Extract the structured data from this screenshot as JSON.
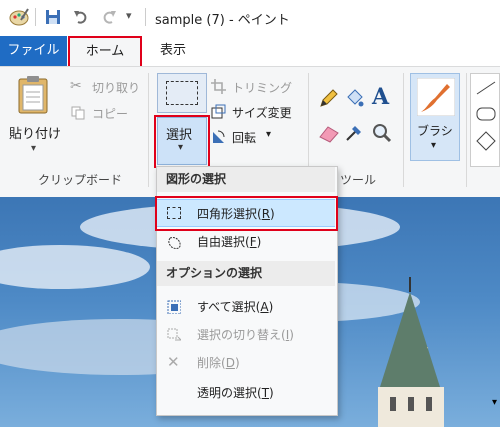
{
  "window": {
    "title": "sample (7) - ペイント"
  },
  "tabs": {
    "file": "ファイル",
    "home": "ホーム",
    "view": "表示"
  },
  "ribbon": {
    "clipboard": {
      "group_label": "クリップボード",
      "paste": "貼り付け",
      "cut": "切り取り",
      "copy": "コピー"
    },
    "image": {
      "select": "選択",
      "crop": "トリミング",
      "resize": "サイズ変更",
      "rotate": "回転"
    },
    "tools": {
      "group_label": "ツール"
    },
    "brushes": {
      "label": "ブラシ"
    }
  },
  "select_menu": {
    "shape_header": "図形の選択",
    "options_header": "オプションの選択",
    "items": [
      {
        "label": "四角形選択(",
        "key": "R",
        "close": ")",
        "enabled": true
      },
      {
        "label": "自由選択(",
        "key": "F",
        "close": ")",
        "enabled": true
      },
      {
        "label": "すべて選択(",
        "key": "A",
        "close": ")",
        "enabled": true
      },
      {
        "label": "選択の切り替え(",
        "key": "I",
        "close": ")",
        "enabled": false
      },
      {
        "label": "削除(",
        "key": "D",
        "close": ")",
        "enabled": false
      },
      {
        "label": "透明の選択(",
        "key": "T",
        "close": ")",
        "enabled": true
      }
    ]
  },
  "colors": {
    "accent": "#1f6cc4",
    "highlight": "#e0001a",
    "hover": "#cce8ff"
  }
}
